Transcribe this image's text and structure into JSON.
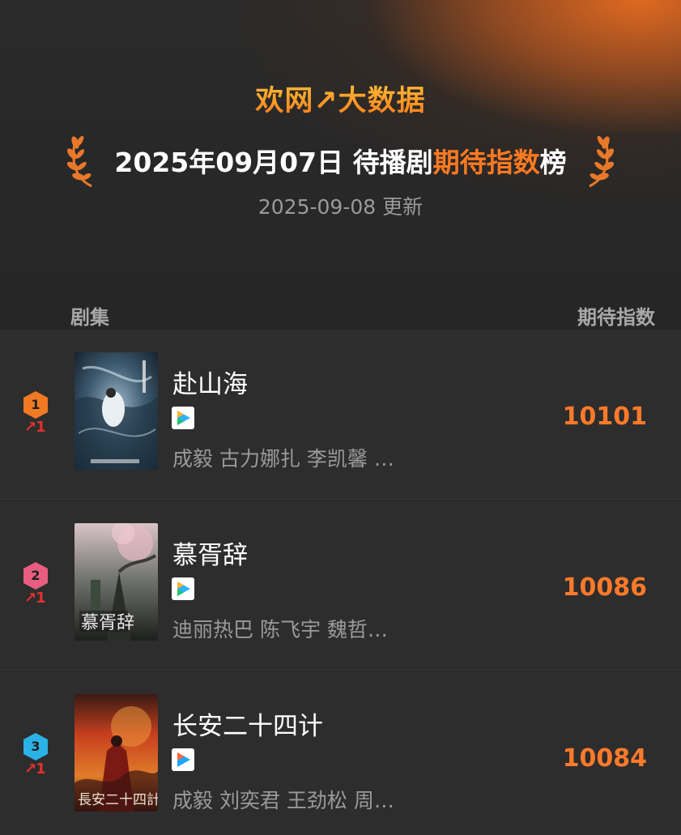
{
  "header": {
    "brand": "欢网↗大数据",
    "title_date": "2025年09月07日 待播剧",
    "title_highlight": "期待指数",
    "title_suffix": "榜",
    "updated": "2025-09-08 更新"
  },
  "columns": {
    "series": "剧集",
    "index": "期待指数"
  },
  "colors": {
    "accent": "#ff7a2a",
    "rank1": "#f07a24",
    "rank2": "#e75d80",
    "rank3": "#2bb2e6",
    "trend": "#e0322f"
  },
  "rows": [
    {
      "rank": "1",
      "trend": "↗1",
      "title": "赴山海",
      "platform_icon": "tencent-video-icon",
      "cast": "成毅 古力娜扎 李凯馨 …",
      "score": "10101"
    },
    {
      "rank": "2",
      "trend": "↗1",
      "title": "慕胥辞",
      "platform_icon": "tencent-video-icon",
      "cast": "迪丽热巴 陈飞宇 魏哲…",
      "score": "10086"
    },
    {
      "rank": "3",
      "trend": "↗1",
      "title": "长安二十四计",
      "platform_icon": "youku-icon",
      "cast": "成毅 刘奕君 王劲松 周…",
      "score": "10084"
    }
  ]
}
